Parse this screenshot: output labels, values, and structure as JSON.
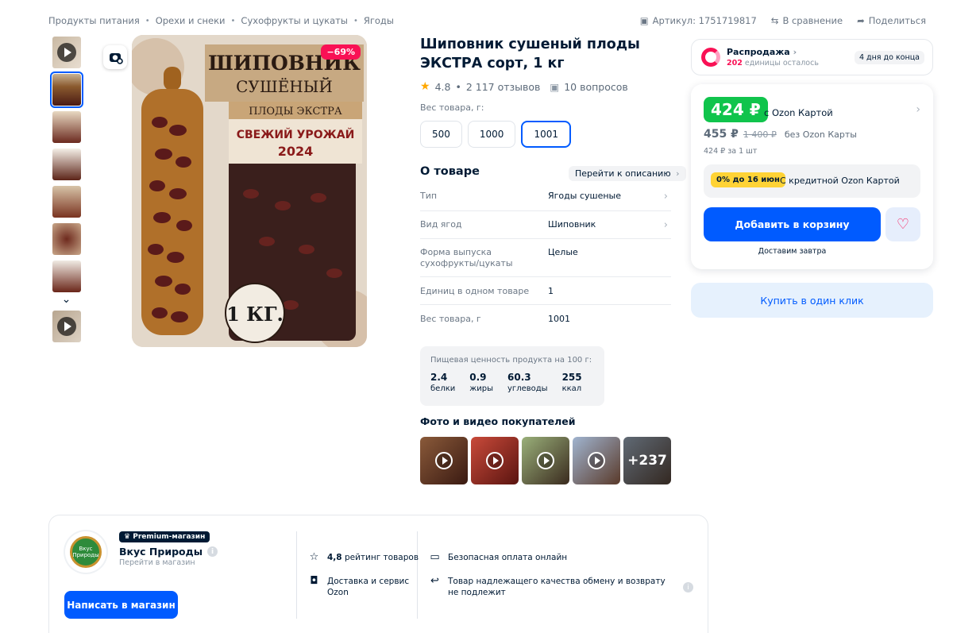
{
  "breadcrumbs": [
    "Продукты питания",
    "Орехи и снеки",
    "Сухофрукты и цукаты",
    "Ягоды"
  ],
  "top_actions": {
    "article": "Артикул: 1751719817",
    "compare": "В сравнение",
    "share": "Поделиться"
  },
  "gallery": {
    "discount_badge": "−69%",
    "image_text": {
      "title1": "ШИПОВНИК",
      "title2": "СУШЁНЫЙ",
      "subtitle": "ПЛОДЫ ЭКСТРА",
      "harvest1": "СВЕЖИЙ УРОЖАЙ",
      "harvest2": "2024",
      "weight": "1 КГ."
    }
  },
  "product": {
    "title": "Шиповник сушеный плоды ЭКСТРА сорт, 1 кг",
    "rating": "4.8",
    "reviews": "2 117 отзывов",
    "questions": "10 вопросов",
    "weight_label": "Вес товара, г:",
    "weights": [
      "500",
      "1000",
      "1001"
    ],
    "selected_weight": "1001"
  },
  "about": {
    "heading": "О товаре",
    "to_description": "Перейти к описанию",
    "specs": [
      {
        "key": "Тип",
        "value": "Ягоды сушеные"
      },
      {
        "key": "Вид ягод",
        "value": "Шиповник"
      },
      {
        "key": "Форма выпуска сухофрукты/цукаты",
        "value": "Целые"
      },
      {
        "key": "Единиц в одном товаре",
        "value": "1"
      },
      {
        "key": "Вес товара, г",
        "value": "1001"
      }
    ]
  },
  "nutrition": {
    "heading": "Пищевая ценность продукта на 100 г:",
    "items": [
      {
        "value": "2.4",
        "label": "белки"
      },
      {
        "value": "0.9",
        "label": "жиры"
      },
      {
        "value": "60.3",
        "label": "углеводы"
      },
      {
        "value": "255",
        "label": "ккал"
      }
    ]
  },
  "customer_photos": {
    "heading": "Фото и видео покупателей",
    "more": "+237"
  },
  "sale": {
    "title": "Распродажа",
    "remaining_count": "202",
    "remaining_text": "единицы осталось",
    "days_left": "4 дня до конца"
  },
  "price": {
    "card_price": "424 ₽",
    "card_label": "с Ozon Картой",
    "regular_price": "455 ₽",
    "old_price": "1 400 ₽",
    "no_card_label": "без Ozon Карты",
    "unit_price": "424 ₽ за 1 шт",
    "credit_badge": "0% до 16 июн",
    "credit_text": "С кредитной Ozon Картой",
    "add_to_cart": "Добавить в корзину",
    "delivery": "Доставим завтра",
    "one_click": "Купить в один клик"
  },
  "seller": {
    "badge": "Premium-магазин",
    "name": "Вкус Природы",
    "goto": "Перейти в магазин",
    "logo_text": "Вкус Природы",
    "write_button": "Написать в магазин",
    "rating_value": "4,8",
    "rating_text": "рейтинг товаров",
    "delivery_text": "Доставка и сервис Ozon",
    "payment_text": "Безопасная оплата онлайн",
    "return_text": "Товар надлежащего качества обмену и возврату не подлежит"
  },
  "colors": {
    "accent_blue": "#005bff",
    "price_green": "#10c44c",
    "sale_pink": "#f91155"
  }
}
